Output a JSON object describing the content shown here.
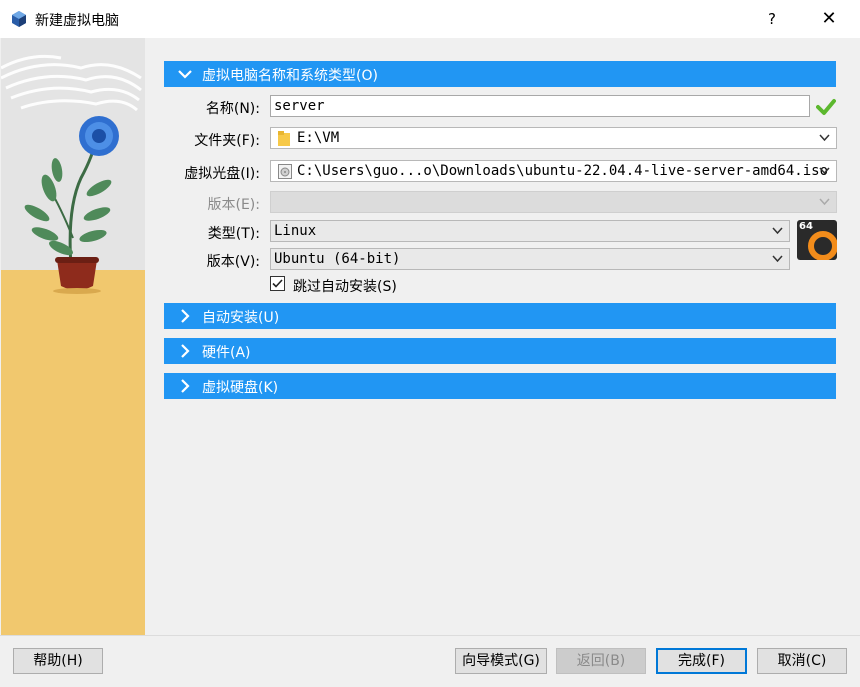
{
  "window": {
    "title": "新建虚拟电脑",
    "help_glyph": "?",
    "close_glyph": "✕"
  },
  "sections": {
    "name_os": {
      "label": "虚拟电脑名称和系统类型(O)",
      "expanded": true
    },
    "unattended": {
      "label": "自动安装(U)",
      "expanded": false
    },
    "hardware": {
      "label": "硬件(A)",
      "expanded": false
    },
    "hard_disk": {
      "label": "虚拟硬盘(K)",
      "expanded": false
    }
  },
  "form": {
    "name_label": "名称(N):",
    "name_value": "server",
    "folder_label": "文件夹(F):",
    "folder_value": "E:\\VM",
    "iso_label": "虚拟光盘(I):",
    "iso_value": "C:\\Users\\guo...o\\Downloads\\ubuntu-22.04.4-live-server-amd64.iso",
    "edition_label": "版本(E):",
    "edition_value": "",
    "type_label": "类型(T):",
    "type_value": "Linux",
    "version_label": "版本(V):",
    "version_value": "Ubuntu (64-bit)",
    "os_badge": "64",
    "skip_unattended_label": "跳过自动安装(S)",
    "skip_unattended_checked": true
  },
  "footer": {
    "help": "帮助(H)",
    "guided_mode": "向导模式(G)",
    "back": "返回(B)",
    "finish": "完成(F)",
    "cancel": "取消(C)"
  },
  "colors": {
    "accent": "#2196f3",
    "valid_check": "#5cb82e",
    "sidebar_floor": "#f1c86e"
  }
}
